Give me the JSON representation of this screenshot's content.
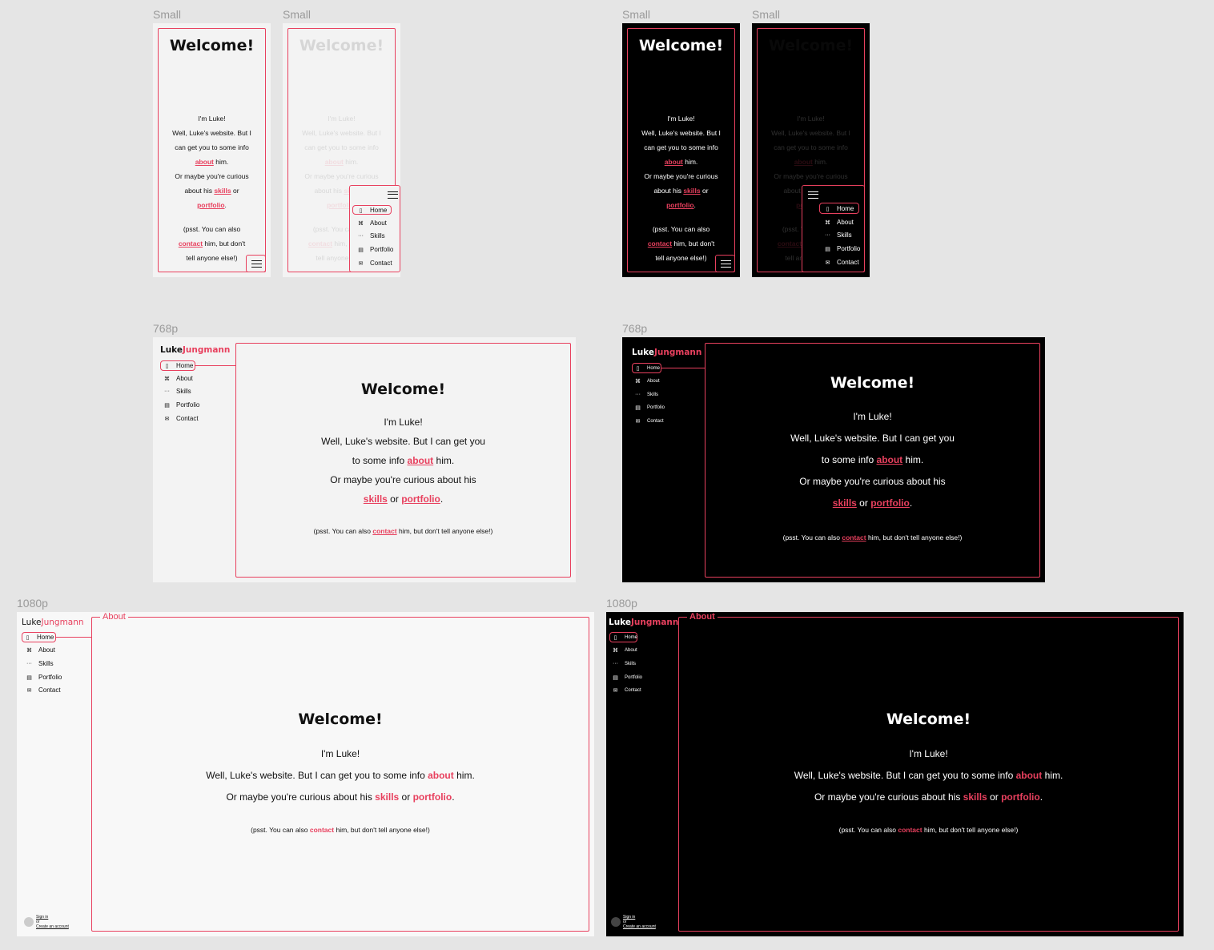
{
  "labels": {
    "small": "Small",
    "p768": "768p",
    "p1080": "1080p"
  },
  "colors": {
    "accent": "#e8405e",
    "light_bg": "#f3f3f3",
    "dark_bg": "#000000",
    "canvas": "#e5e5e5"
  },
  "welcome": "Welcome!",
  "intro": {
    "im_luke": "I'm Luke!",
    "line1a": "Well, Luke's website. But I",
    "line1b": "can get you to some info",
    "about_link": "about",
    "him": "him.",
    "line3a": "Or maybe you're curious",
    "line3b": "about his",
    "skills_link": "skills",
    "or": "or",
    "portfolio_link": "portfolio",
    "period": ".",
    "psst_a": "(psst. You can also",
    "contact_link": "contact",
    "psst_b": "him, but don't",
    "psst_c": "tell anyone else!)",
    "m_line1": "Well, Luke's website. But I can get you",
    "m_line2a": "to some info",
    "m_line3": "Or maybe you're curious about his",
    "w_line1": "Well, Luke's website. But I can get you to some info",
    "w_line2": "Or maybe you're curious about his",
    "psst_full_a": "(psst. You can also",
    "psst_full_b": "him, but don't tell anyone else!)"
  },
  "logo": {
    "first": "Luke",
    "last": "Jungmann"
  },
  "nav": {
    "items": [
      {
        "label": "Home",
        "icon": "bookmark-icon"
      },
      {
        "label": "About",
        "icon": "user-icon"
      },
      {
        "label": "Skills",
        "icon": "dots-icon"
      },
      {
        "label": "Portfolio",
        "icon": "file-icon"
      },
      {
        "label": "Contact",
        "icon": "mail-icon"
      }
    ]
  },
  "about_tag": "About",
  "account": {
    "sign_in": "Sign in",
    "or": "or",
    "create": "Create an account"
  }
}
